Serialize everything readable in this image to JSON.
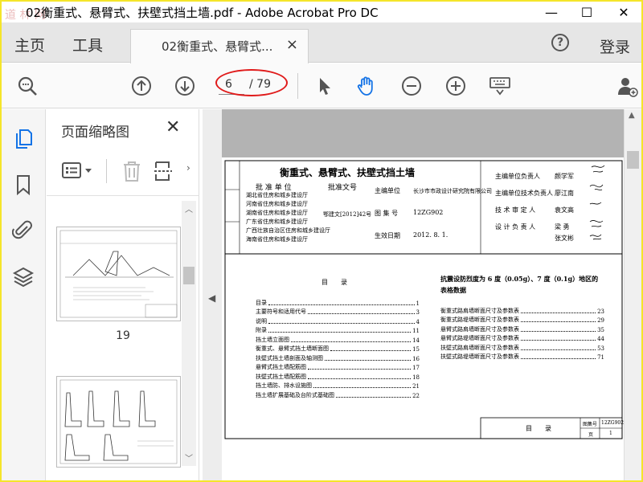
{
  "window": {
    "watermark": "道 林 网",
    "title": "02衡重式、悬臂式、扶壁式挡土墙.pdf - Adobe Acrobat Pro DC",
    "minimize": "—",
    "maximize": "☐",
    "close": "✕"
  },
  "menu": {
    "home": "主页",
    "tools": "工具",
    "tab_label": "02衡重式、悬臂式...",
    "tab_close": "×",
    "help": "?",
    "login": "登录"
  },
  "toolbar": {
    "current_page": "6",
    "total_pages": "/ 79",
    "icons": [
      "zoom-search-icon",
      "page-up-icon",
      "page-down-icon",
      "select-cursor-icon",
      "hand-tool-icon",
      "zoom-out-icon",
      "zoom-in-icon",
      "keyboard-icon",
      "add-user-icon"
    ]
  },
  "rail": {
    "icons": [
      "page-thumbnails-icon",
      "bookmark-icon",
      "attachment-icon",
      "layers-icon"
    ]
  },
  "panel": {
    "title": "页面缩略图",
    "close": "✕",
    "thumb1_label": "19"
  },
  "document": {
    "title": "衡重式、悬臂式、扶壁式挡土墙",
    "approve_unit_label": "批 准 单 位",
    "approve_doc_label": "批准文号",
    "approve_units": [
      "湖北省住房和城乡建设厅",
      "河南省住房和城乡建设厅",
      "湖南省住房和城乡建设厅",
      "广东省住房和城乡建设厅",
      "广西壮族自治区住房和城乡建设厅",
      "海南省住房和城乡建设厅"
    ],
    "approve_doc": "鄂建文[2012]42号",
    "main_unit_label": "主编单位",
    "main_unit": "长沙市市政设计研究院有限公司",
    "atlas_no_label": "图 集 号",
    "atlas_no": "12ZG902",
    "effective_label": "生效日期",
    "effective_date": "2012. 8. 1.",
    "staff": [
      {
        "role": "主编单位负责人",
        "name": "颜学军"
      },
      {
        "role": "主编单位技术负责人",
        "name": "廖江南"
      },
      {
        "role": "技 术 审 定 人",
        "name": "袁文高"
      },
      {
        "role": "设 计 负 责 人",
        "name": "梁 勇"
      },
      {
        "role": "",
        "name": "张文彬"
      }
    ],
    "toc_title": "目　　录",
    "toc": [
      {
        "text": "目录",
        "page": "1"
      },
      {
        "text": "主要符号和适用代号",
        "page": "3"
      },
      {
        "text": "说明",
        "page": "4"
      },
      {
        "text": "附录",
        "page": "11"
      },
      {
        "text": "挡土墙立面图",
        "page": "14"
      },
      {
        "text": "衡重式、悬臂式挡土墙断面图",
        "page": "15"
      },
      {
        "text": "扶壁式挡土墙剖面及轴测图",
        "page": "16"
      },
      {
        "text": "悬臂式挡土墙配筋图",
        "page": "17"
      },
      {
        "text": "扶壁式挡土墙配筋图",
        "page": "18"
      },
      {
        "text": "挡土墙防、排水设施图",
        "page": "21"
      },
      {
        "text": "挡土墙扩展基础及台阶式基础图",
        "page": "22"
      }
    ],
    "seismic_title_1": "抗震设防烈度为 6 度（0.05g）、7 度（0.1g）地区的",
    "seismic_title_2": "表格数据",
    "seismic": [
      {
        "text": "衡重式路肩墙断面尺寸及参数表",
        "page": "23"
      },
      {
        "text": "衡重式路堤墙断面尺寸及参数表",
        "page": "29"
      },
      {
        "text": "悬臂式路肩墙断面尺寸及参数表",
        "page": "35"
      },
      {
        "text": "悬臂式路堤墙断面尺寸及参数表",
        "page": "44"
      },
      {
        "text": "扶壁式路肩墙断面尺寸及参数表",
        "page": "53"
      },
      {
        "text": "扶壁式路堤墙断面尺寸及参数表",
        "page": "71"
      }
    ],
    "footer_title": "目　　录",
    "footer_atlas_label": "图集号",
    "footer_atlas_no": "12ZG902",
    "footer_page_label": "页",
    "footer_page": "1"
  }
}
